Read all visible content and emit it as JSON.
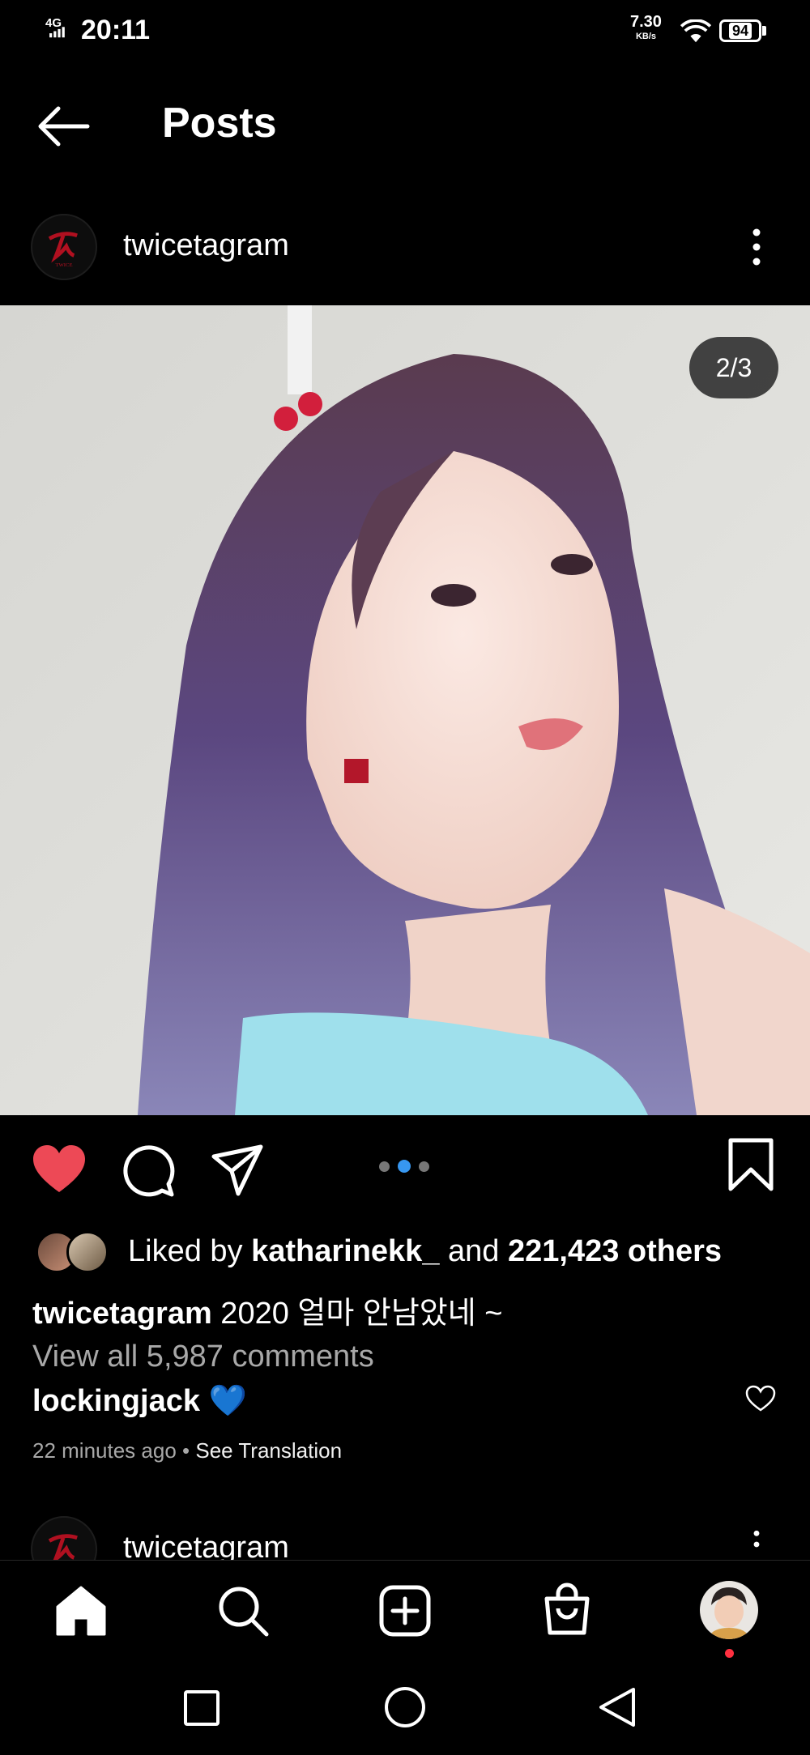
{
  "status_bar": {
    "time": "20:11",
    "network": "4G",
    "speed_value": "7.30",
    "speed_unit": "KB/s",
    "battery": "94",
    "icons": [
      "signal-icon",
      "wifi-icon",
      "battery-icon"
    ]
  },
  "header": {
    "title": "Posts",
    "back_icon": "arrow-left-icon"
  },
  "post": {
    "username": "twicetagram",
    "image_counter": "2/3",
    "carousel_total": 3,
    "carousel_index": 2,
    "liked_by_prefix": "Liked by ",
    "liked_by_user": "katharinekk_",
    "liked_by_and": " and ",
    "liked_by_count": "221,423 others",
    "caption_user": "twicetagram",
    "caption_text": " 2020 얼마 안남았네 ~",
    "view_all": "View all 5,987 comments",
    "comment_user": "lockingjack",
    "comment_emoji": "💙",
    "time_ago": "22 minutes ago",
    "separator": " • ",
    "see_translation": "See Translation",
    "liked": true
  },
  "next_post": {
    "username": "twicetagram"
  },
  "bottom_nav": {
    "items": [
      "home-icon",
      "search-icon",
      "create-post-icon",
      "shop-icon",
      "profile-avatar"
    ]
  },
  "colors": {
    "background": "#000000",
    "like_red": "#ed4956",
    "carousel_active": "#3797f0",
    "secondary_text": "#a8a8a8",
    "notification_dot": "#ff3040"
  }
}
